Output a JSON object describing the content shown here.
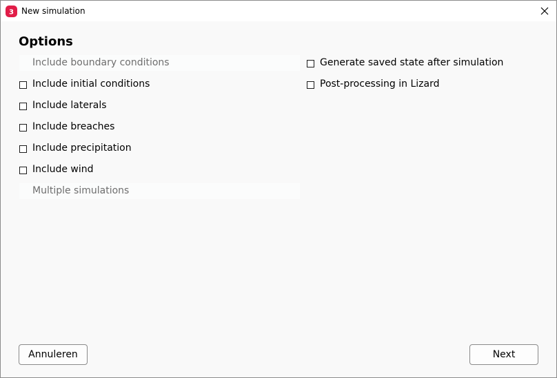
{
  "window": {
    "title": "New simulation",
    "app_icon": "3di-logo-icon",
    "close_icon": "close-icon"
  },
  "options": {
    "heading": "Options",
    "left_column": [
      {
        "label": "Include boundary conditions",
        "type": "disabled"
      },
      {
        "label": "Include initial conditions",
        "type": "checkbox",
        "checked": false
      },
      {
        "label": "Include laterals",
        "type": "checkbox",
        "checked": false
      },
      {
        "label": "Include breaches",
        "type": "checkbox",
        "checked": false
      },
      {
        "label": "Include precipitation",
        "type": "checkbox",
        "checked": false
      },
      {
        "label": "Include wind",
        "type": "checkbox",
        "checked": false
      },
      {
        "label": "Multiple simulations",
        "type": "disabled"
      }
    ],
    "right_column": [
      {
        "label": "Generate saved state after simulation",
        "type": "checkbox",
        "checked": false
      },
      {
        "label": "Post-processing in Lizard",
        "type": "checkbox",
        "checked": false
      }
    ]
  },
  "buttons": {
    "cancel_label": "Annuleren",
    "next_label": "Next"
  },
  "colors": {
    "accent": "#e11d48",
    "background": "#f9f9f9",
    "disabled_text": "#6e6e6e"
  }
}
